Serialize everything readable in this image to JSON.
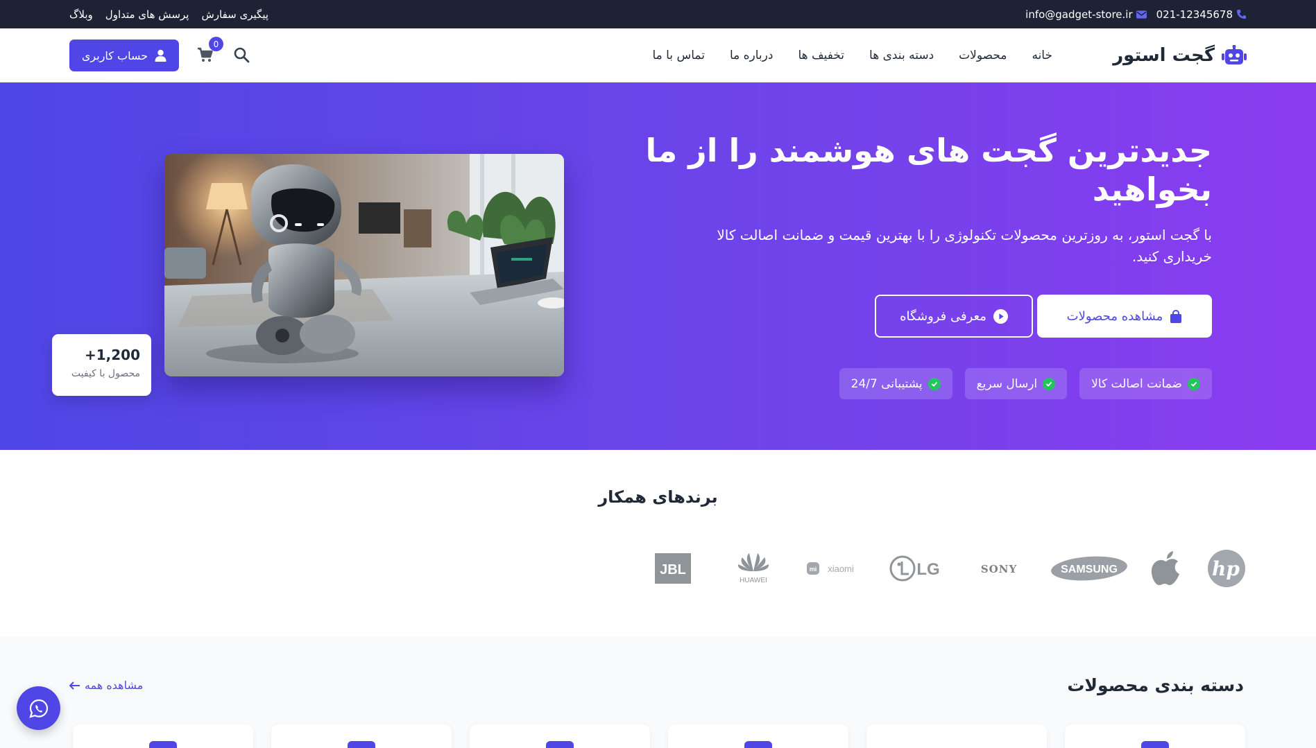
{
  "topbar": {
    "phone": "021-12345678",
    "email": "info@gadget-store.ir",
    "links": [
      "پیگیری سفارش",
      "پرسش های متداول",
      "وبلاگ"
    ]
  },
  "navbar": {
    "brand": "گجت استور",
    "menu": [
      "خانه",
      "محصولات",
      "دسته بندی ها",
      "تخفیف ها",
      "درباره ما",
      "تماس با ما"
    ],
    "account_label": "حساب کاربری",
    "cart_count": "0"
  },
  "hero": {
    "title": "جدیدترین گجت های هوشمند را از ما بخواهید",
    "subtitle": "با گجت استور، به روزترین محصولات تکنولوژی را با بهترین قیمت و ضمانت اصالت کالا خریداری کنید.",
    "primary_button": "مشاهده محصولات",
    "secondary_button": "معرفی فروشگاه",
    "features": [
      "ضمانت اصالت کالا",
      "ارسال سریع",
      "پشتیبانی 24/7"
    ],
    "stat_value": "+1,200",
    "stat_label": "محصول با کیفیت"
  },
  "brands": {
    "title": "برندهای همکار",
    "logos": [
      "hp",
      "Apple",
      "SAMSUNG",
      "SONY",
      "LG",
      "xiaomi",
      "HUAWEI",
      "JBL"
    ]
  },
  "categories": {
    "title": "دسته بندی محصولات",
    "view_all": "مشاهده همه"
  },
  "colors": {
    "accent": "#4f46e5",
    "hero_gradient_end": "#8b3cf0",
    "topbar": "#1e2235",
    "check": "#22c55e"
  }
}
